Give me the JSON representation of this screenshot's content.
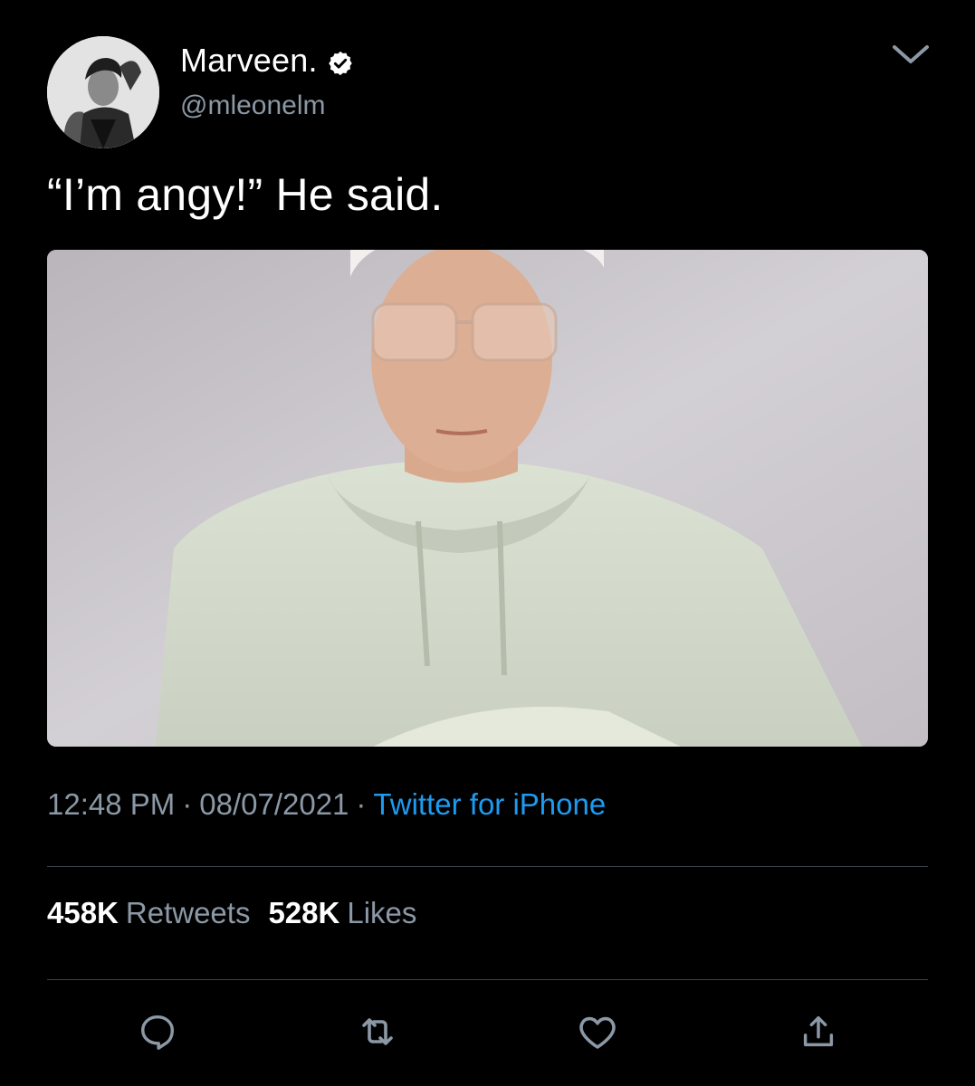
{
  "author": {
    "display_name": "Marveen.",
    "handle": "@mleonelm",
    "verified": true,
    "avatar_icon": "avatar-portrait"
  },
  "tweet": {
    "text": "“I’m angy!” He said.",
    "media_icon": "photo-person-white-hoodie"
  },
  "meta": {
    "time": "12:48 PM",
    "separator": "·",
    "date": "08/07/2021",
    "source": "Twitter for iPhone"
  },
  "stats": {
    "retweets_count": "458K",
    "retweets_label": "Retweets",
    "likes_count": "528K",
    "likes_label": "Likes"
  },
  "actions": {
    "reply_icon": "reply-icon",
    "retweet_icon": "retweet-icon",
    "like_icon": "heart-icon",
    "share_icon": "share-icon"
  },
  "colors": {
    "background": "#000000",
    "text_primary": "#ffffff",
    "text_secondary": "#8b98a5",
    "link": "#1d9bf0",
    "divider": "#38444d"
  }
}
